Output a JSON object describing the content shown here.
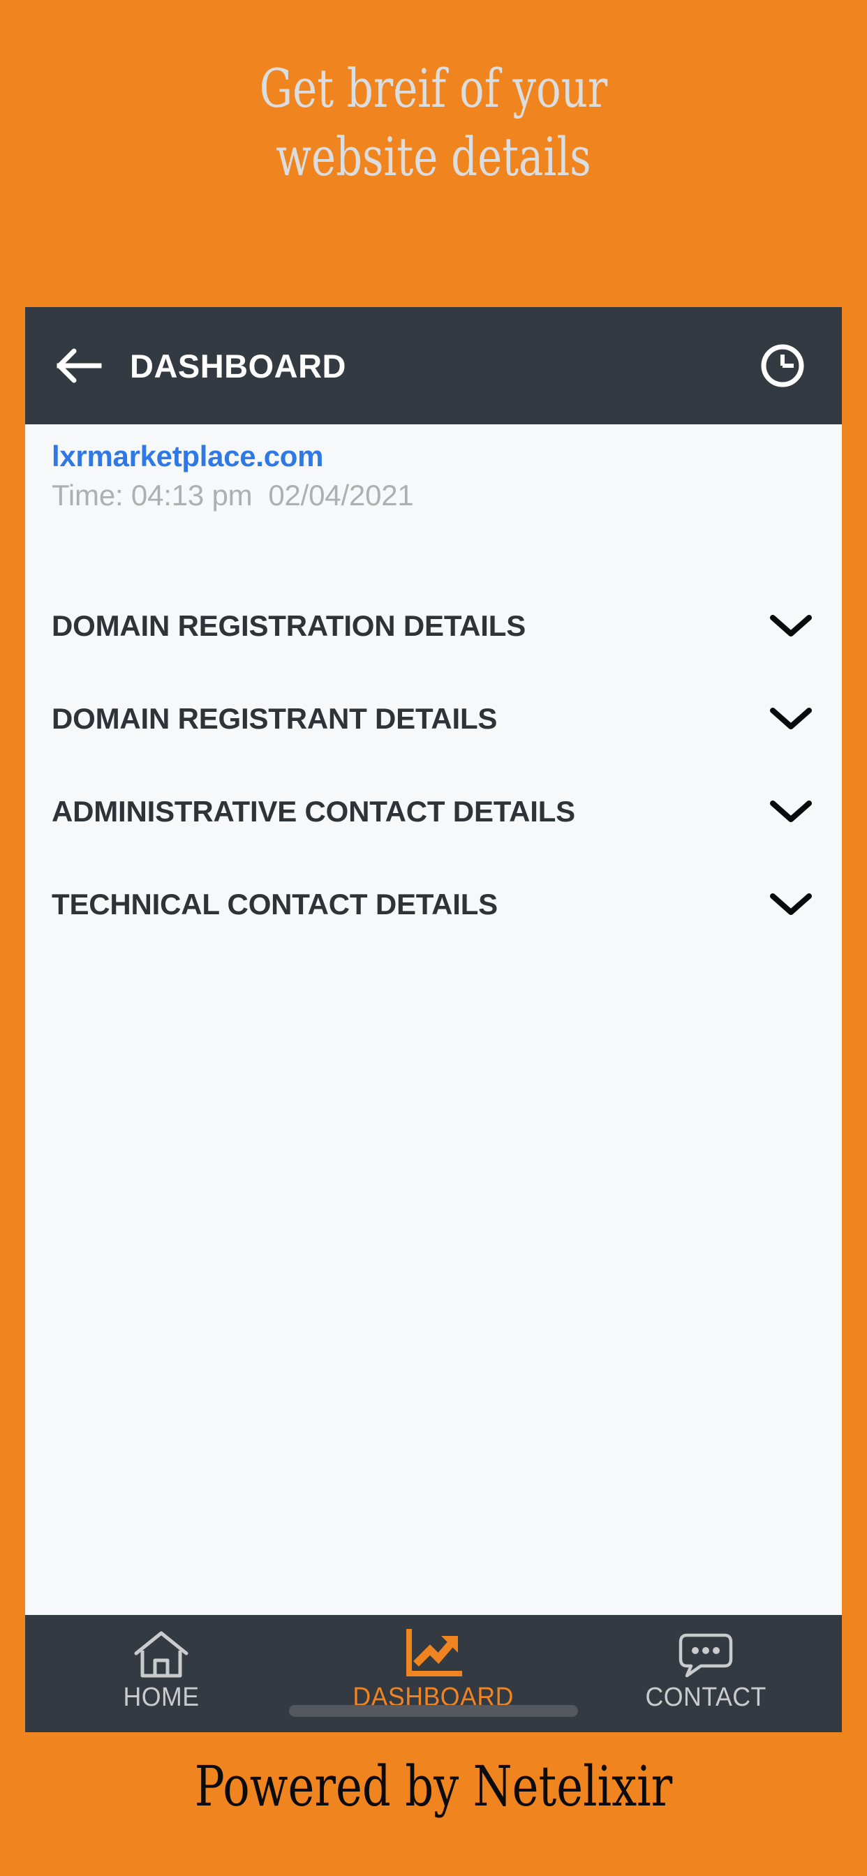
{
  "colors": {
    "brand_orange": "#F0841F",
    "panel_background": "#F6F8F9",
    "dark_bar": "#343A42",
    "link_blue": "#2F79E4",
    "muted_gray": "#ADAFB2",
    "heading_dark": "#2E3338",
    "nav_inactive": "#C9CBCD",
    "nav_active": "#F08421",
    "promo_text": "#DCDDDE",
    "footer_text": "#0B0B0B"
  },
  "promo": {
    "headline": "Get breif of your\nwebsite details"
  },
  "app_bar": {
    "title": "DASHBOARD",
    "back_icon": "arrow-left-icon",
    "history_icon": "clock-icon"
  },
  "site_info": {
    "domain": "lxrmarketplace.com",
    "time_line": "Time: 04:13 pm  02/04/2021",
    "time_label": "Time:",
    "time_value": "04:13 pm",
    "date_value": "02/04/2021"
  },
  "accordion": {
    "chevron_icon": "chevron-down-icon",
    "items": [
      {
        "label": "DOMAIN REGISTRATION DETAILS",
        "expanded": false
      },
      {
        "label": "DOMAIN REGISTRANT DETAILS",
        "expanded": false
      },
      {
        "label": "ADMINISTRATIVE CONTACT DETAILS",
        "expanded": false
      },
      {
        "label": "TECHNICAL CONTACT DETAILS",
        "expanded": false
      }
    ]
  },
  "bottom_nav": {
    "items": [
      {
        "label": "HOME",
        "icon": "home-icon",
        "active": false
      },
      {
        "label": "DASHBOARD",
        "icon": "chart-arrow-up-icon",
        "active": true
      },
      {
        "label": "CONTACT",
        "icon": "chat-bubble-icon",
        "active": false
      }
    ]
  },
  "footer": {
    "text": "Powered by Netelixir"
  }
}
